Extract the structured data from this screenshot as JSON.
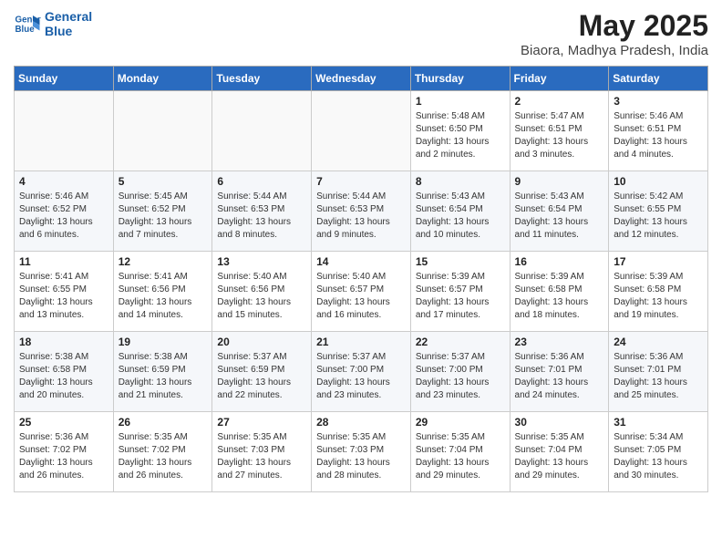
{
  "header": {
    "logo_line1": "General",
    "logo_line2": "Blue",
    "title": "May 2025",
    "subtitle": "Biaora, Madhya Pradesh, India"
  },
  "weekdays": [
    "Sunday",
    "Monday",
    "Tuesday",
    "Wednesday",
    "Thursday",
    "Friday",
    "Saturday"
  ],
  "weeks": [
    [
      {
        "day": "",
        "text": ""
      },
      {
        "day": "",
        "text": ""
      },
      {
        "day": "",
        "text": ""
      },
      {
        "day": "",
        "text": ""
      },
      {
        "day": "1",
        "text": "Sunrise: 5:48 AM\nSunset: 6:50 PM\nDaylight: 13 hours\nand 2 minutes."
      },
      {
        "day": "2",
        "text": "Sunrise: 5:47 AM\nSunset: 6:51 PM\nDaylight: 13 hours\nand 3 minutes."
      },
      {
        "day": "3",
        "text": "Sunrise: 5:46 AM\nSunset: 6:51 PM\nDaylight: 13 hours\nand 4 minutes."
      }
    ],
    [
      {
        "day": "4",
        "text": "Sunrise: 5:46 AM\nSunset: 6:52 PM\nDaylight: 13 hours\nand 6 minutes."
      },
      {
        "day": "5",
        "text": "Sunrise: 5:45 AM\nSunset: 6:52 PM\nDaylight: 13 hours\nand 7 minutes."
      },
      {
        "day": "6",
        "text": "Sunrise: 5:44 AM\nSunset: 6:53 PM\nDaylight: 13 hours\nand 8 minutes."
      },
      {
        "day": "7",
        "text": "Sunrise: 5:44 AM\nSunset: 6:53 PM\nDaylight: 13 hours\nand 9 minutes."
      },
      {
        "day": "8",
        "text": "Sunrise: 5:43 AM\nSunset: 6:54 PM\nDaylight: 13 hours\nand 10 minutes."
      },
      {
        "day": "9",
        "text": "Sunrise: 5:43 AM\nSunset: 6:54 PM\nDaylight: 13 hours\nand 11 minutes."
      },
      {
        "day": "10",
        "text": "Sunrise: 5:42 AM\nSunset: 6:55 PM\nDaylight: 13 hours\nand 12 minutes."
      }
    ],
    [
      {
        "day": "11",
        "text": "Sunrise: 5:41 AM\nSunset: 6:55 PM\nDaylight: 13 hours\nand 13 minutes."
      },
      {
        "day": "12",
        "text": "Sunrise: 5:41 AM\nSunset: 6:56 PM\nDaylight: 13 hours\nand 14 minutes."
      },
      {
        "day": "13",
        "text": "Sunrise: 5:40 AM\nSunset: 6:56 PM\nDaylight: 13 hours\nand 15 minutes."
      },
      {
        "day": "14",
        "text": "Sunrise: 5:40 AM\nSunset: 6:57 PM\nDaylight: 13 hours\nand 16 minutes."
      },
      {
        "day": "15",
        "text": "Sunrise: 5:39 AM\nSunset: 6:57 PM\nDaylight: 13 hours\nand 17 minutes."
      },
      {
        "day": "16",
        "text": "Sunrise: 5:39 AM\nSunset: 6:58 PM\nDaylight: 13 hours\nand 18 minutes."
      },
      {
        "day": "17",
        "text": "Sunrise: 5:39 AM\nSunset: 6:58 PM\nDaylight: 13 hours\nand 19 minutes."
      }
    ],
    [
      {
        "day": "18",
        "text": "Sunrise: 5:38 AM\nSunset: 6:58 PM\nDaylight: 13 hours\nand 20 minutes."
      },
      {
        "day": "19",
        "text": "Sunrise: 5:38 AM\nSunset: 6:59 PM\nDaylight: 13 hours\nand 21 minutes."
      },
      {
        "day": "20",
        "text": "Sunrise: 5:37 AM\nSunset: 6:59 PM\nDaylight: 13 hours\nand 22 minutes."
      },
      {
        "day": "21",
        "text": "Sunrise: 5:37 AM\nSunset: 7:00 PM\nDaylight: 13 hours\nand 23 minutes."
      },
      {
        "day": "22",
        "text": "Sunrise: 5:37 AM\nSunset: 7:00 PM\nDaylight: 13 hours\nand 23 minutes."
      },
      {
        "day": "23",
        "text": "Sunrise: 5:36 AM\nSunset: 7:01 PM\nDaylight: 13 hours\nand 24 minutes."
      },
      {
        "day": "24",
        "text": "Sunrise: 5:36 AM\nSunset: 7:01 PM\nDaylight: 13 hours\nand 25 minutes."
      }
    ],
    [
      {
        "day": "25",
        "text": "Sunrise: 5:36 AM\nSunset: 7:02 PM\nDaylight: 13 hours\nand 26 minutes."
      },
      {
        "day": "26",
        "text": "Sunrise: 5:35 AM\nSunset: 7:02 PM\nDaylight: 13 hours\nand 26 minutes."
      },
      {
        "day": "27",
        "text": "Sunrise: 5:35 AM\nSunset: 7:03 PM\nDaylight: 13 hours\nand 27 minutes."
      },
      {
        "day": "28",
        "text": "Sunrise: 5:35 AM\nSunset: 7:03 PM\nDaylight: 13 hours\nand 28 minutes."
      },
      {
        "day": "29",
        "text": "Sunrise: 5:35 AM\nSunset: 7:04 PM\nDaylight: 13 hours\nand 29 minutes."
      },
      {
        "day": "30",
        "text": "Sunrise: 5:35 AM\nSunset: 7:04 PM\nDaylight: 13 hours\nand 29 minutes."
      },
      {
        "day": "31",
        "text": "Sunrise: 5:34 AM\nSunset: 7:05 PM\nDaylight: 13 hours\nand 30 minutes."
      }
    ]
  ]
}
